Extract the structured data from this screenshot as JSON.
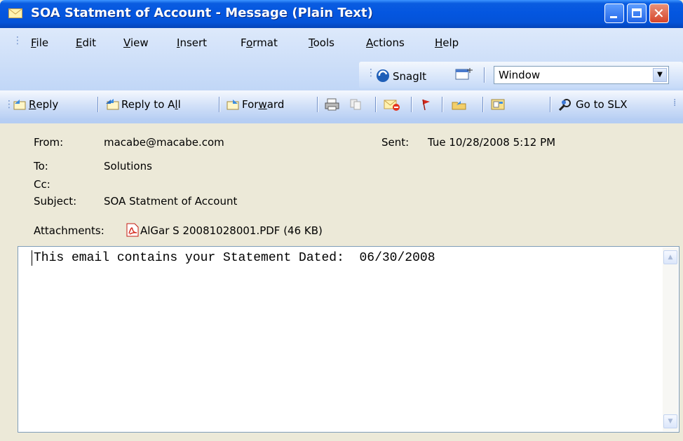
{
  "window": {
    "title": "SOA Statment of Account - Message (Plain Text)",
    "controls": {
      "minimize_icon": "minimize-icon",
      "maximize_icon": "maximize-icon",
      "close_icon": "close-icon"
    }
  },
  "menu": {
    "items": [
      {
        "label": "File",
        "underline": "F",
        "rest": "ile"
      },
      {
        "label": "Edit",
        "underline": "E",
        "rest": "dit"
      },
      {
        "label": "View",
        "underline": "V",
        "rest": "iew"
      },
      {
        "label": "Insert",
        "underline": "I",
        "rest": "nsert"
      },
      {
        "label": "Format",
        "pre": "F",
        "underline": "o",
        "rest": "rmat"
      },
      {
        "label": "Tools",
        "underline": "T",
        "rest": "ools"
      },
      {
        "label": "Actions",
        "underline": "A",
        "rest": "ctions"
      },
      {
        "label": "Help",
        "underline": "H",
        "rest": "elp"
      }
    ]
  },
  "snagit_toolbar": {
    "snagit_label": "SnagIt",
    "dropdown_value": "Window"
  },
  "standard_toolbar": {
    "reply": {
      "pre": "",
      "ul": "R",
      "rest": "eply"
    },
    "reply_all": {
      "pre": "Reply to A",
      "ul": "l",
      "rest": "l"
    },
    "forward": {
      "pre": "For",
      "ul": "w",
      "rest": "ard"
    },
    "go_to_slx": "Go to SLX"
  },
  "message": {
    "from_label": "From:",
    "from_value": "macabe@macabe.com",
    "sent_label": "Sent:",
    "sent_value": "Tue 10/28/2008 5:12 PM",
    "to_label": "To:",
    "to_value": "Solutions",
    "cc_label": "Cc:",
    "cc_value": "",
    "subject_label": "Subject:",
    "subject_value": "SOA Statment of Account",
    "attachments_label": "Attachments:",
    "attachment_name": "AlGar S 20081028001.PDF (46 KB)",
    "body": "This email contains your Statement Dated:  06/30/2008"
  },
  "colors": {
    "titlebar": "#0456e0",
    "toolbar": "#c3d8f7",
    "panel": "#ece9d8",
    "close_button": "#d6452a"
  }
}
